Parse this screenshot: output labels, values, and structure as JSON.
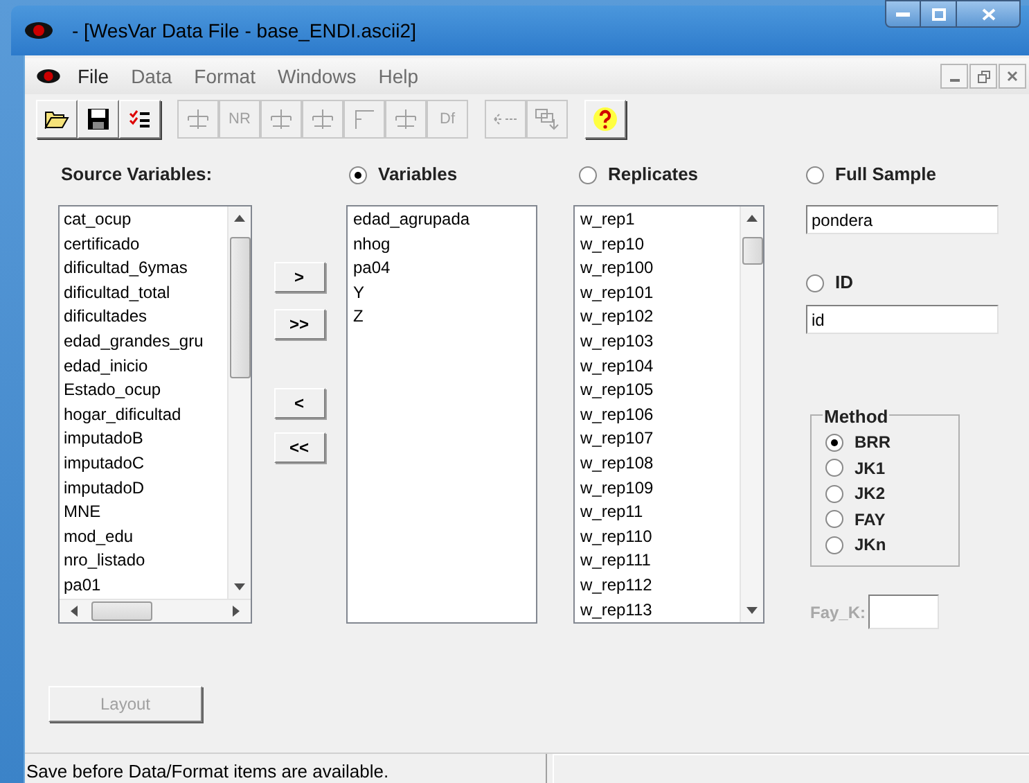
{
  "window": {
    "title": "- [WesVar Data File - base_ENDI.ascii2]"
  },
  "menu": [
    {
      "label": "File",
      "disabled": false
    },
    {
      "label": "Data",
      "disabled": true
    },
    {
      "label": "Format",
      "disabled": true
    },
    {
      "label": "Windows",
      "disabled": true
    },
    {
      "label": "Help",
      "disabled": true
    }
  ],
  "toolbar": [
    {
      "kind": "open",
      "disabled": false
    },
    {
      "kind": "save",
      "disabled": false
    },
    {
      "kind": "checklist",
      "disabled": false
    },
    {
      "kind": "sep"
    },
    {
      "kind": "scale",
      "disabled": true
    },
    {
      "kind": "text",
      "label": "NR",
      "disabled": true
    },
    {
      "kind": "scale",
      "disabled": true
    },
    {
      "kind": "scale",
      "disabled": true
    },
    {
      "kind": "bracket",
      "disabled": true
    },
    {
      "kind": "scale",
      "disabled": true
    },
    {
      "kind": "text",
      "label": "Df",
      "disabled": true
    },
    {
      "kind": "sep"
    },
    {
      "kind": "link",
      "disabled": true
    },
    {
      "kind": "windows",
      "disabled": true
    },
    {
      "kind": "sep"
    },
    {
      "kind": "help",
      "disabled": false
    }
  ],
  "source": {
    "label": "Source Variables:",
    "items": [
      "cat_ocup",
      "certificado",
      "dificultad_6ymas",
      "dificultad_total",
      "dificultades",
      "edad_grandes_gru",
      "edad_inicio",
      "Estado_ocup",
      "hogar_dificultad",
      "imputadoB",
      "imputadoC",
      "imputadoD",
      "MNE",
      "mod_edu",
      "nro_listado",
      "pa01"
    ]
  },
  "move_buttons": [
    ">",
    ">>",
    "<",
    "<<"
  ],
  "variables": {
    "label": "Variables",
    "selected": true,
    "items": [
      "edad_agrupada",
      "nhog",
      "pa04",
      "Y",
      "Z"
    ]
  },
  "replicates": {
    "label": "Replicates",
    "selected": false,
    "items": [
      "w_rep1",
      "w_rep10",
      "w_rep100",
      "w_rep101",
      "w_rep102",
      "w_rep103",
      "w_rep104",
      "w_rep105",
      "w_rep106",
      "w_rep107",
      "w_rep108",
      "w_rep109",
      "w_rep11",
      "w_rep110",
      "w_rep111",
      "w_rep112",
      "w_rep113"
    ]
  },
  "full_sample": {
    "label": "Full Sample",
    "selected": false,
    "value": "pondera"
  },
  "id": {
    "label": "ID",
    "selected": false,
    "value": "id"
  },
  "method": {
    "label": "Method",
    "options": [
      {
        "label": "BRR",
        "selected": true
      },
      {
        "label": "JK1",
        "selected": false
      },
      {
        "label": "JK2",
        "selected": false
      },
      {
        "label": "FAY",
        "selected": false
      },
      {
        "label": "JKn",
        "selected": false
      }
    ]
  },
  "fay_k": {
    "label": "Fay_K:",
    "disabled": true
  },
  "layout_button": {
    "label": "Layout",
    "disabled": true
  },
  "status_bar": [
    "Save before Data/Format items are available."
  ]
}
